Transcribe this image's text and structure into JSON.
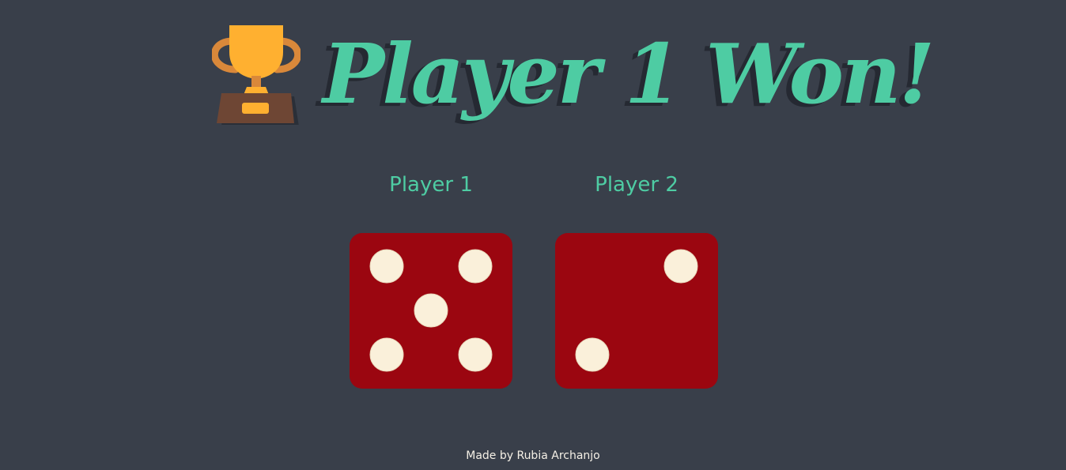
{
  "header": {
    "title": "Player 1 Won!",
    "icon": "trophy-icon"
  },
  "players": [
    {
      "label": "Player 1",
      "dice_value": 5
    },
    {
      "label": "Player 2",
      "dice_value": 2
    }
  ],
  "footer": {
    "credit": "Made by Rubia Archanjo"
  },
  "colors": {
    "background": "#393f4a",
    "accent": "#4ecca3",
    "die_face": "#9b0610",
    "pip": "#faf0da",
    "trophy_cup": "#ffb030",
    "trophy_handles": "#d9883a",
    "trophy_base": "#6e4634",
    "footer_text": "#f5f0e6"
  }
}
